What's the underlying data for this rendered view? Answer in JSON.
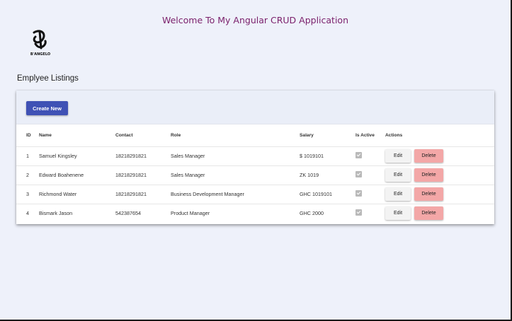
{
  "header": {
    "welcome": "Welcome To My Angular CRUD Application",
    "logo_text": "B'ANGELO"
  },
  "page_title": "Emplyee Listings",
  "toolbar": {
    "create_label": "Create New"
  },
  "table": {
    "columns": [
      "ID",
      "Name",
      "Contact",
      "Role",
      "Salary",
      "Is Active",
      "Actions"
    ],
    "rows": [
      {
        "id": "1",
        "name": "Samuel Kingsley",
        "contact": "18218291821",
        "role": "Sales Manager",
        "salary": "$ 1019101",
        "active": true
      },
      {
        "id": "2",
        "name": "Edward Boahenene",
        "contact": "18218291821",
        "role": "Sales Manager",
        "salary": "ZK 1019",
        "active": true
      },
      {
        "id": "3",
        "name": "Richmond Water",
        "contact": "18218291821",
        "role": "Business Development Manager",
        "salary": "GHC 1019101",
        "active": true
      },
      {
        "id": "4",
        "name": "Bismark Jason",
        "contact": "542387654",
        "role": "Product Manager",
        "salary": "GHC 2000",
        "active": true
      }
    ],
    "edit_label": "Edit",
    "delete_label": "Delete"
  },
  "colors": {
    "primary": "#3f51b5",
    "delete": "#f3a7a7",
    "welcome_text": "#7a1f6b",
    "background": "#eef1fa"
  }
}
